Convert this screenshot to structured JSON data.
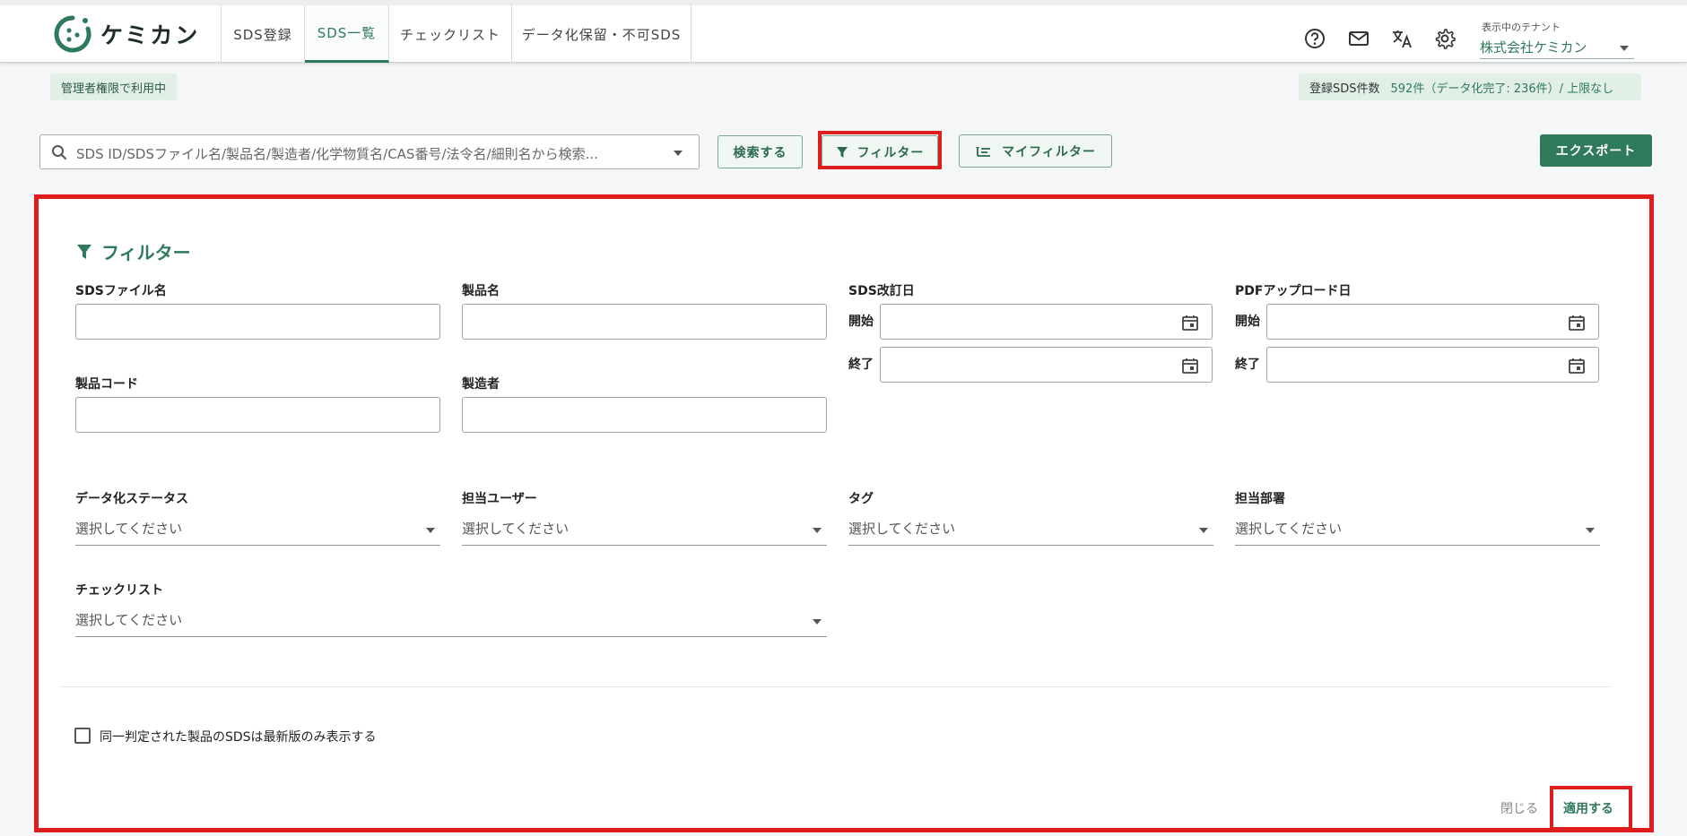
{
  "header": {
    "logo_text": "ケミカン",
    "tabs": [
      {
        "label": "SDS登録"
      },
      {
        "label": "SDS一覧"
      },
      {
        "label": "チェックリスト"
      },
      {
        "label": "データ化保留・不可SDS"
      }
    ],
    "icons": [
      "help-icon",
      "mail-icon",
      "translate-icon",
      "gear-icon"
    ],
    "tenant_caption": "表示中のテナント",
    "tenant_value": "株式会社ケミカン"
  },
  "subheader": {
    "admin_badge": "管理者権限で利用中",
    "count_label": "登録SDS件数",
    "count_value": "592件（データ化完了: 236件）/ 上限なし"
  },
  "toolbar": {
    "search_placeholder": "SDS ID/SDSファイル名/製品名/製造者/化学物質名/CAS番号/法令名/細則名から検索...",
    "search_button": "検索する",
    "filter_button": "フィルター",
    "myfilter_button": "マイフィルター",
    "export_button": "エクスポート"
  },
  "filter_panel": {
    "title": "フィルター",
    "sds_file_name_label": "SDSファイル名",
    "product_name_label": "製品名",
    "product_code_label": "製品コード",
    "manufacturer_label": "製造者",
    "sds_revision_label": "SDS改訂日",
    "pdf_upload_label": "PDFアップロード日",
    "start_label": "開始",
    "end_label": "終了",
    "data_status_label": "データ化ステータス",
    "assigned_user_label": "担当ユーザー",
    "tag_label": "タグ",
    "department_label": "担当部署",
    "checklist_label": "チェックリスト",
    "select_placeholder": "選択してください",
    "latest_only_label": "同一判定された製品のSDSは最新版のみ表示する",
    "close_label": "閉じる",
    "apply_label": "適用する"
  },
  "colors": {
    "brand_green": "#2f7a5a",
    "highlight_red": "#e01d1d",
    "badge_bg": "#e1efe7"
  }
}
